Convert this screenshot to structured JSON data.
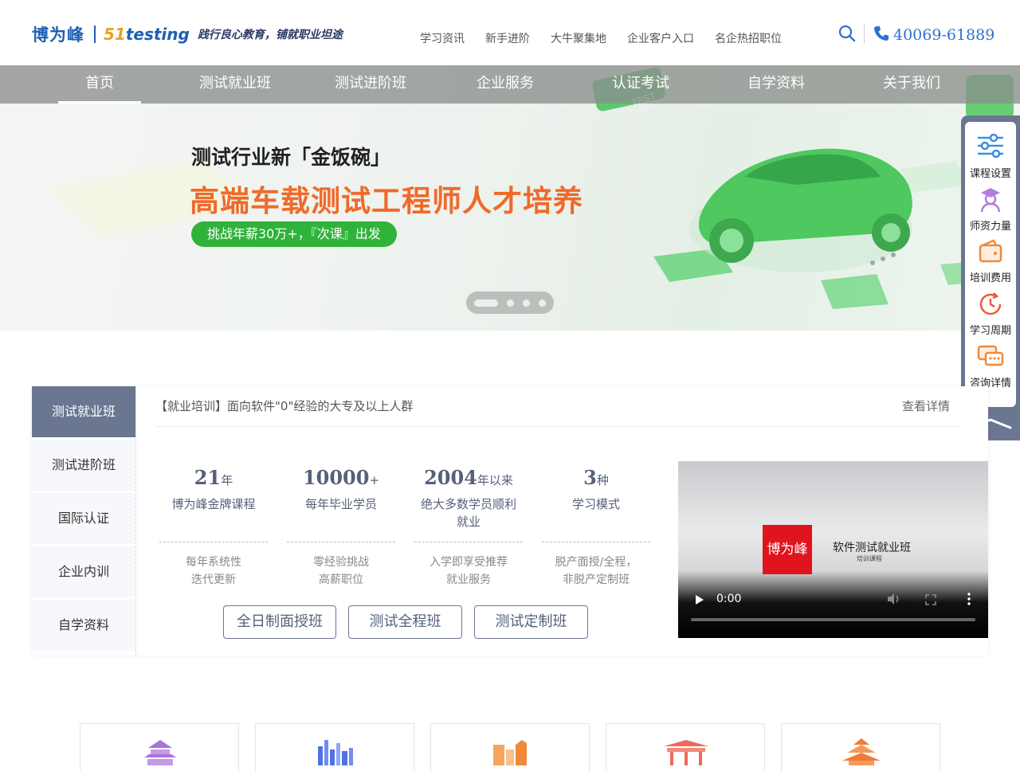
{
  "header": {
    "logo_cn": "博为峰",
    "logo_en_prefix": "51",
    "logo_en": "testing",
    "slogan": "践行良心教育，铺就职业坦途",
    "links": [
      "学习资讯",
      "新手进阶",
      "大牛聚集地",
      "企业客户入口",
      "名企热招职位"
    ],
    "phone": "40069-61889",
    "accent": "#2f6fd4"
  },
  "nav": {
    "items": [
      "首页",
      "测试就业班",
      "测试进阶班",
      "企业服务",
      "认证考试",
      "自学资料",
      "关于我们"
    ],
    "active_index": 0
  },
  "banner": {
    "line1": "测试行业新「金饭碗」",
    "line2": "高端车载测试工程师人才培养",
    "pill": "挑战年薪30万+，『次课』出发",
    "slides": 4,
    "active_slide": 0,
    "pill_color": "#2fb33a",
    "headline_color": "#ef6a2a"
  },
  "sidebar": {
    "items": [
      {
        "label": "课程设置",
        "icon": "sliders-icon"
      },
      {
        "label": "师资力量",
        "icon": "teacher-icon"
      },
      {
        "label": "培训费用",
        "icon": "wallet-icon"
      },
      {
        "label": "学习周期",
        "icon": "clock-cycle-icon"
      },
      {
        "label": "咨询详情",
        "icon": "chat-icon"
      }
    ],
    "top_icon": "chevron-up-icon"
  },
  "courses": {
    "tabs": [
      "测试就业班",
      "测试进阶班",
      "国际认证",
      "企业内训",
      "自学资料"
    ],
    "active_tab": 0,
    "headline": "【就业培训】面向软件\"0\"经验的大专及以上人群",
    "more": "查看详情",
    "stats": [
      {
        "num": "21",
        "unit": "年",
        "desc": "博为峰金牌课程",
        "note1": "每年系统性",
        "note2": "迭代更新"
      },
      {
        "num": "10000",
        "unit": "+",
        "desc": "每年毕业学员",
        "note1": "零经验挑战",
        "note2": "高薪职位"
      },
      {
        "num": "2004",
        "unit": "年以来",
        "desc": "绝大多数学员顺利就业",
        "note1": "入学即享受推荐",
        "note2": "就业服务"
      },
      {
        "num": "3",
        "unit": "种",
        "desc": "学习模式",
        "note1": "脱产面授/全程，",
        "note2": "非脱产定制班"
      }
    ],
    "buttons": [
      "全日制面授班",
      "测试全程班",
      "测试定制班"
    ],
    "video": {
      "logo": "博为峰",
      "title": "软件测试就业班",
      "subtitle": "培训课程",
      "time": "0:00"
    }
  },
  "cities": {
    "icons": [
      "temple-icon",
      "skyline-icon",
      "tower-icon",
      "pavilion-icon",
      "pagoda-icon"
    ]
  }
}
